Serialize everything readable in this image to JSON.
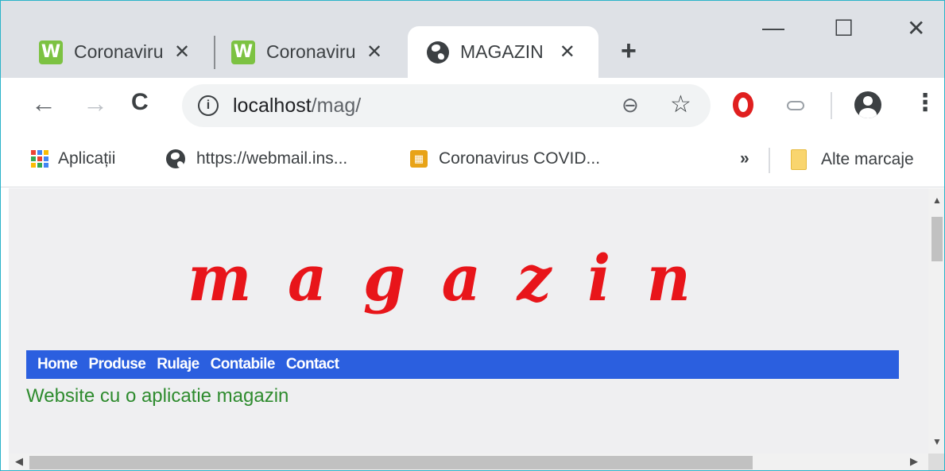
{
  "tabs": [
    {
      "title": "Coronaviru",
      "close": "✕",
      "favicon": "worldometer-icon"
    },
    {
      "title": "Coronaviru",
      "close": "✕",
      "favicon": "worldometer-icon"
    },
    {
      "title": "MAGAZIN",
      "close": "✕",
      "favicon": "globe-icon",
      "active": true
    }
  ],
  "new_tab": "+",
  "window_controls": {
    "minimize": "—",
    "maximize": "☐",
    "close": "✕"
  },
  "toolbar": {
    "back": "←",
    "forward": "→",
    "reload": "C",
    "info": "i",
    "url_host": "localhost",
    "url_path": "/mag/",
    "zoom": "⊖",
    "star": "☆",
    "menu": "⋮"
  },
  "bookmarks": {
    "apps": "Aplicații",
    "items": [
      {
        "label": "https://webmail.ins...",
        "icon": "globe-icon"
      },
      {
        "label": "Coronavirus COVID...",
        "icon": "dashboard-icon"
      }
    ],
    "overflow": "»",
    "other": "Alte marcaje"
  },
  "page": {
    "logo": "magazin",
    "nav": [
      "Home",
      "Produse",
      "Rulaje",
      "Contabile",
      "Contact"
    ],
    "tagline": "Website cu o aplicatie magazin"
  },
  "colors": {
    "logo": "#e8151a",
    "navbar": "#2b5fdf",
    "tagline": "#2e8b2e",
    "tabstrip": "#dee1e6",
    "page_bg": "#efeff1"
  }
}
